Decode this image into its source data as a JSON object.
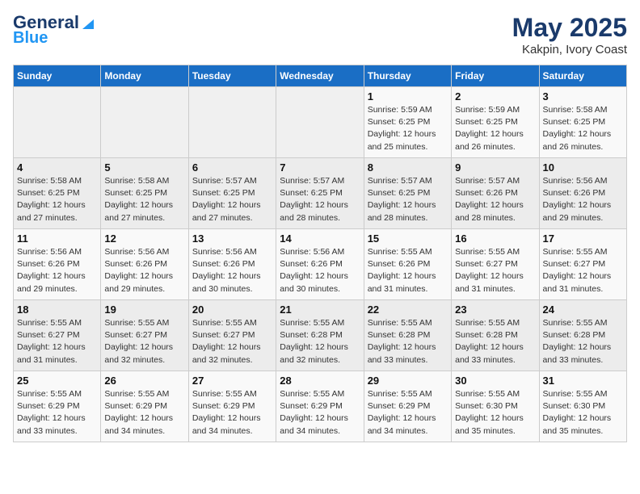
{
  "logo": {
    "line1": "General",
    "line2": "Blue"
  },
  "title": {
    "month_year": "May 2025",
    "location": "Kakpin, Ivory Coast"
  },
  "days_of_week": [
    "Sunday",
    "Monday",
    "Tuesday",
    "Wednesday",
    "Thursday",
    "Friday",
    "Saturday"
  ],
  "weeks": [
    [
      {
        "day": "",
        "detail": ""
      },
      {
        "day": "",
        "detail": ""
      },
      {
        "day": "",
        "detail": ""
      },
      {
        "day": "",
        "detail": ""
      },
      {
        "day": "1",
        "detail": "Sunrise: 5:59 AM\nSunset: 6:25 PM\nDaylight: 12 hours\nand 25 minutes."
      },
      {
        "day": "2",
        "detail": "Sunrise: 5:59 AM\nSunset: 6:25 PM\nDaylight: 12 hours\nand 26 minutes."
      },
      {
        "day": "3",
        "detail": "Sunrise: 5:58 AM\nSunset: 6:25 PM\nDaylight: 12 hours\nand 26 minutes."
      }
    ],
    [
      {
        "day": "4",
        "detail": "Sunrise: 5:58 AM\nSunset: 6:25 PM\nDaylight: 12 hours\nand 27 minutes."
      },
      {
        "day": "5",
        "detail": "Sunrise: 5:58 AM\nSunset: 6:25 PM\nDaylight: 12 hours\nand 27 minutes."
      },
      {
        "day": "6",
        "detail": "Sunrise: 5:57 AM\nSunset: 6:25 PM\nDaylight: 12 hours\nand 27 minutes."
      },
      {
        "day": "7",
        "detail": "Sunrise: 5:57 AM\nSunset: 6:25 PM\nDaylight: 12 hours\nand 28 minutes."
      },
      {
        "day": "8",
        "detail": "Sunrise: 5:57 AM\nSunset: 6:25 PM\nDaylight: 12 hours\nand 28 minutes."
      },
      {
        "day": "9",
        "detail": "Sunrise: 5:57 AM\nSunset: 6:26 PM\nDaylight: 12 hours\nand 28 minutes."
      },
      {
        "day": "10",
        "detail": "Sunrise: 5:56 AM\nSunset: 6:26 PM\nDaylight: 12 hours\nand 29 minutes."
      }
    ],
    [
      {
        "day": "11",
        "detail": "Sunrise: 5:56 AM\nSunset: 6:26 PM\nDaylight: 12 hours\nand 29 minutes."
      },
      {
        "day": "12",
        "detail": "Sunrise: 5:56 AM\nSunset: 6:26 PM\nDaylight: 12 hours\nand 29 minutes."
      },
      {
        "day": "13",
        "detail": "Sunrise: 5:56 AM\nSunset: 6:26 PM\nDaylight: 12 hours\nand 30 minutes."
      },
      {
        "day": "14",
        "detail": "Sunrise: 5:56 AM\nSunset: 6:26 PM\nDaylight: 12 hours\nand 30 minutes."
      },
      {
        "day": "15",
        "detail": "Sunrise: 5:55 AM\nSunset: 6:26 PM\nDaylight: 12 hours\nand 31 minutes."
      },
      {
        "day": "16",
        "detail": "Sunrise: 5:55 AM\nSunset: 6:27 PM\nDaylight: 12 hours\nand 31 minutes."
      },
      {
        "day": "17",
        "detail": "Sunrise: 5:55 AM\nSunset: 6:27 PM\nDaylight: 12 hours\nand 31 minutes."
      }
    ],
    [
      {
        "day": "18",
        "detail": "Sunrise: 5:55 AM\nSunset: 6:27 PM\nDaylight: 12 hours\nand 31 minutes."
      },
      {
        "day": "19",
        "detail": "Sunrise: 5:55 AM\nSunset: 6:27 PM\nDaylight: 12 hours\nand 32 minutes."
      },
      {
        "day": "20",
        "detail": "Sunrise: 5:55 AM\nSunset: 6:27 PM\nDaylight: 12 hours\nand 32 minutes."
      },
      {
        "day": "21",
        "detail": "Sunrise: 5:55 AM\nSunset: 6:28 PM\nDaylight: 12 hours\nand 32 minutes."
      },
      {
        "day": "22",
        "detail": "Sunrise: 5:55 AM\nSunset: 6:28 PM\nDaylight: 12 hours\nand 33 minutes."
      },
      {
        "day": "23",
        "detail": "Sunrise: 5:55 AM\nSunset: 6:28 PM\nDaylight: 12 hours\nand 33 minutes."
      },
      {
        "day": "24",
        "detail": "Sunrise: 5:55 AM\nSunset: 6:28 PM\nDaylight: 12 hours\nand 33 minutes."
      }
    ],
    [
      {
        "day": "25",
        "detail": "Sunrise: 5:55 AM\nSunset: 6:29 PM\nDaylight: 12 hours\nand 33 minutes."
      },
      {
        "day": "26",
        "detail": "Sunrise: 5:55 AM\nSunset: 6:29 PM\nDaylight: 12 hours\nand 34 minutes."
      },
      {
        "day": "27",
        "detail": "Sunrise: 5:55 AM\nSunset: 6:29 PM\nDaylight: 12 hours\nand 34 minutes."
      },
      {
        "day": "28",
        "detail": "Sunrise: 5:55 AM\nSunset: 6:29 PM\nDaylight: 12 hours\nand 34 minutes."
      },
      {
        "day": "29",
        "detail": "Sunrise: 5:55 AM\nSunset: 6:29 PM\nDaylight: 12 hours\nand 34 minutes."
      },
      {
        "day": "30",
        "detail": "Sunrise: 5:55 AM\nSunset: 6:30 PM\nDaylight: 12 hours\nand 35 minutes."
      },
      {
        "day": "31",
        "detail": "Sunrise: 5:55 AM\nSunset: 6:30 PM\nDaylight: 12 hours\nand 35 minutes."
      }
    ]
  ]
}
